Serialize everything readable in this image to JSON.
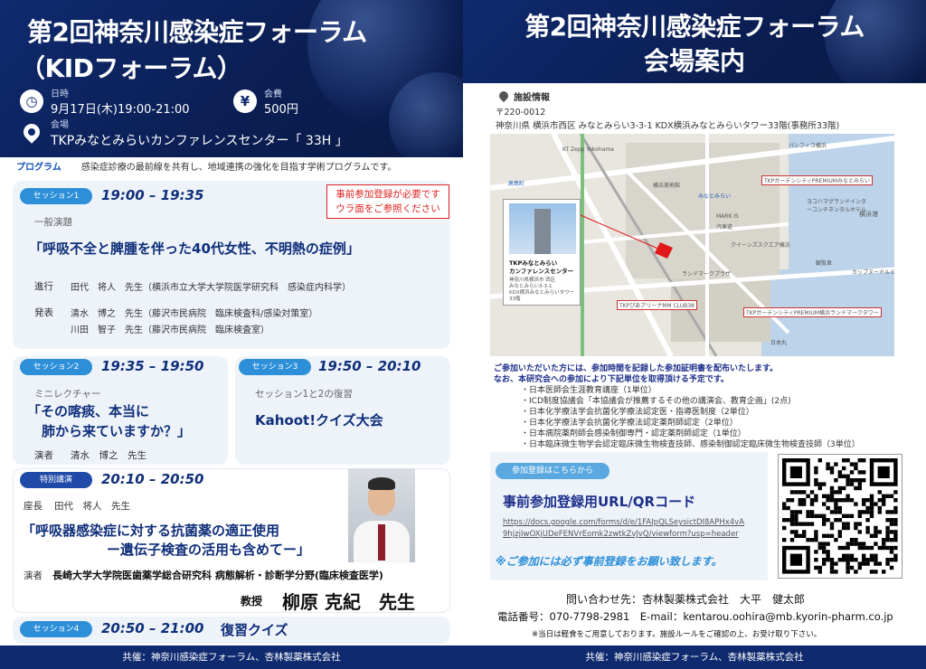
{
  "left": {
    "title_line1": "第2回神奈川感染症フォーラム",
    "title_line2": "（KIDフォーラム）",
    "date_label": "日時",
    "date_value": "9月17日(木)19:00-21:00",
    "fee_label": "会費",
    "fee_value": "500円",
    "venue_label": "会場",
    "venue_value": "TKPみなとみらいカンファレンスセンター「 33H 」",
    "program_label": "プログラム",
    "program_desc": "感染症診療の最前線を共有し、地域連携の強化を目指す学術プログラムです。",
    "notice_line1": "事前参加登録が必要です",
    "notice_line2": "ウラ面をご参照ください",
    "session1": {
      "badge": "セッション1",
      "time": "19:00 – 19:35",
      "category": "一般演題",
      "title": "「呼吸不全と脾腫を伴った40代女性、不明熱の症例」",
      "chair_label": "進行",
      "chair": "田代　将人　先生（横浜市立大学大学院医学研究科　感染症内科学）",
      "presenter_label": "発表",
      "presenter1": "清水　博之　先生（藤沢市民病院　臨床検査科/感染対策室）",
      "presenter2": "川田　智子　先生（藤沢市民病院　臨床検査室）"
    },
    "session2": {
      "badge": "セッション2",
      "time": "19:35 – 19:50",
      "category": "ミニレクチャー",
      "title_line1": "「その喀痰、本当に",
      "title_line2": "肺から来ていますか？」",
      "speaker_label": "演者",
      "speaker": "清水　博之　先生"
    },
    "session3": {
      "badge": "セッション3",
      "time": "19:50 – 20:10",
      "category": "セッション1と2の復習",
      "title": "Kahoot!クイズ大会"
    },
    "special": {
      "badge": "特別講演",
      "time": "20:10 – 20:50",
      "chair_label": "座長",
      "chair": "田代　将人　先生",
      "title_line1": "「呼吸器感染症に対する抗菌薬の適正使用",
      "title_line2": "ー遺伝子検査の活用も含めてー」",
      "speaker_label": "演者",
      "affiliation": "長崎大学大学院医歯薬学総合研究科 病態解析・診断学分野(臨床検査医学)",
      "rank": "教授",
      "speaker": "柳原 克紀　先生"
    },
    "session4": {
      "badge": "セッション4",
      "time": "20:50 – 21:00",
      "title": "復習クイズ"
    },
    "footer": "共催：神奈川感染症フォーラム、杏林製薬株式会社"
  },
  "right": {
    "title_line1": "第2回神奈川感染症フォーラム",
    "title_line2": "会場案内",
    "facility_label": "施設情報",
    "postal": "〒220-0012",
    "address": "神奈川県 横浜市西区 みなとみらい3-3-1 KDX横浜みなとみらいタワー33階(事務所33階)",
    "map": {
      "card_title1": "TKPみなとみらい",
      "card_title2": "カンファレンスセンター",
      "card_addr1": "神奈川県横浜市 西区",
      "card_addr2": "みなとみらい3-3-1",
      "card_addr3": "KDX横浜みなとみらいタワー",
      "card_addr4": "33階",
      "labels": [
        "パシフィコ横浜",
        "TKPガーデンシティPREMIUMみなとみらい",
        "みなとみらい",
        "MARK IS",
        "クイーンズスクエア横浜",
        "ヨコハマグランドインターコンチネンタルホテル",
        "横浜港",
        "観覧車",
        "カップヌードルミュージアム",
        "ランドマークプラザ",
        "TKPぴあアリーナMM CLUB38",
        "TKPガーデンシティPREMIUM横浜ランドマークタワー",
        "高島町",
        "日本丸",
        "汽車道",
        "KT Zepp Yokohama",
        "横浜美術館"
      ]
    },
    "info_line1": "ご参加いただいた方には、参加時間を記録した参加証明書を配布いたします。",
    "info_line2": "なお、本研究会への参加により下記単位を取得頂ける予定です。",
    "credits": [
      "・日本医師会生涯教育講座（1単位）",
      "・ICD制度協議会「本協議会が推薦するその他の講演会、教育企画」(2点)",
      "・日本化学療法学会抗菌化学療法認定医・指導医制度（2単位）",
      "・日本化学療法学会抗菌化学療法認定薬剤師認定（2単位）",
      "・日本病院薬剤師会感染制御専門・認定薬剤師認定（1単位）",
      "・日本臨床微生物学会認定臨床微生物検査技師、感染制御認定臨床微生物検査技師（3単位）"
    ],
    "reg_pill": "参加登録はこちらから",
    "reg_title": "事前参加登録用URL/QRコード",
    "reg_url1": "https://docs.google.com/forms/d/e/1FAIpQLSeysictDI8APHx4vA",
    "reg_url2": "9hjzjIwOXjUDeFENVrEomk2zwtkZvJvQ/viewform?usp=header",
    "reg_note": "※ご参加には必ず事前登録をお願い致します。",
    "contact": "問い合わせ先：杏林製薬株式会社　大平　健太郎",
    "phone": "電話番号：070-7798-2981　E-mail：kentarou.oohira@mb.kyorin-pharm.co.jp",
    "disclaimer": "※当日は軽食をご用意しております。施設ルールをご確認の上、お受け取り下さい。",
    "footer": "共催：神奈川感染症フォーラム、杏林製薬株式会社"
  },
  "colors": {
    "navy": "#0f2a6e",
    "accent_blue": "#2d8fd8",
    "notice_red": "#dd2222"
  },
  "icons": [
    "clock-icon",
    "yen-icon",
    "location-pin-icon",
    "map-pin-icon",
    "qr-code"
  ]
}
